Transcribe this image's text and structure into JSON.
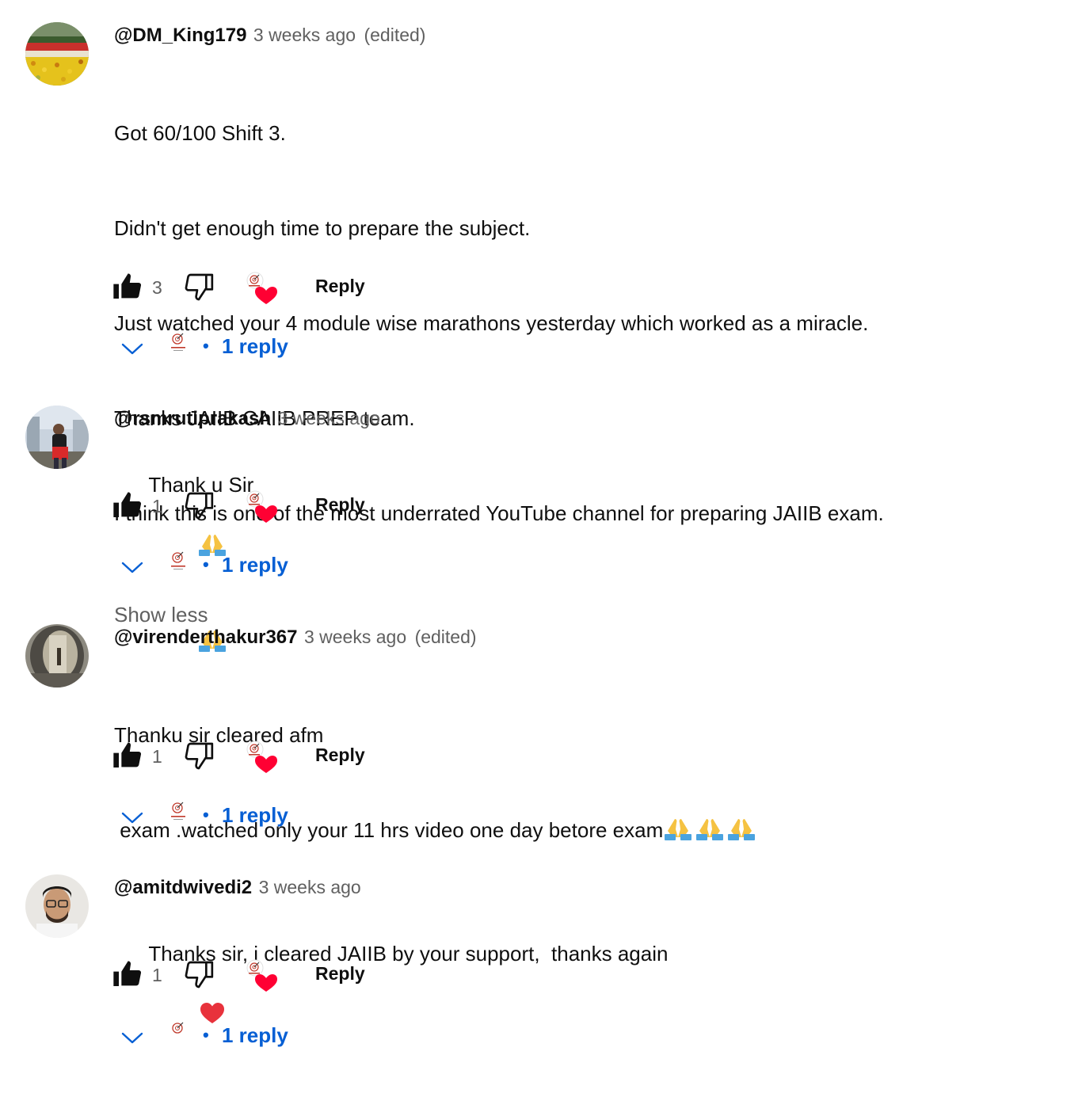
{
  "comments": [
    {
      "author": "@DM_King179",
      "time": "3 weeks ago",
      "edited": "(edited)",
      "lines": [
        "Got 60/100 Shift 3.",
        "Didn't get enough time to prepare the subject.",
        "Just watched your 4 module wise marathons yesterday which worked as a miracle.",
        "Thanks JAIIB CAIIB PREP team.",
        "I think this is one of the most underrated YouTube channel for preparing JAIIB exam."
      ],
      "show_less": "Show less",
      "likes": "3",
      "reply_label": "Reply",
      "replies_dot": "•",
      "replies_label": "1 reply"
    },
    {
      "author": "@rsmrutiprakash",
      "time": "3 weeks ago",
      "text": "Thank u Sir",
      "emoji_count": 2,
      "likes": "1",
      "reply_label": "Reply",
      "replies_dot": "•",
      "replies_label": "1 reply"
    },
    {
      "author": "@virenderthakur367",
      "time": "3 weeks ago",
      "edited": "(edited)",
      "line1": "Thanku sir cleared afm",
      "line2": " exam .watched only your 11 hrs video one day betore exam",
      "emoji_count": 3,
      "likes": "1",
      "reply_label": "Reply",
      "replies_dot": "•",
      "replies_label": "1 reply"
    },
    {
      "author": "@amitdwivedi2",
      "time": "3 weeks ago",
      "text": "Thanks sir, i cleared JAIIB by your support,  thanks again",
      "likes": "1",
      "reply_label": "Reply",
      "replies_dot": "•",
      "replies_label": "1 reply"
    }
  ],
  "icons": {
    "like": "thumbs-up-icon",
    "dislike": "thumbs-down-icon",
    "creator_heart": "creator-heart-icon",
    "expand": "chevron-down-icon",
    "pray": "folded-hands-emoji",
    "heart": "red-heart-emoji"
  },
  "colors": {
    "link_blue": "#065fd4",
    "heart_red": "#ff0033",
    "secondary_text": "#606060",
    "primary_text": "#0f0f0f"
  }
}
